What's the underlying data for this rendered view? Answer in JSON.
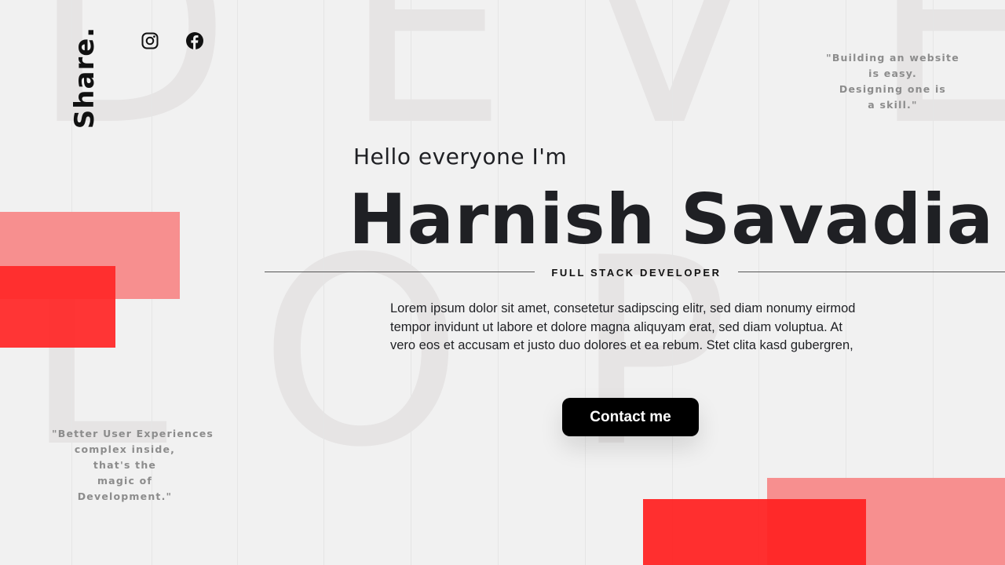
{
  "background_letters": [
    "D",
    "E",
    "V",
    "E",
    "L",
    "O",
    "P"
  ],
  "share": {
    "label": "Share.",
    "social": [
      "instagram-icon",
      "facebook-icon"
    ]
  },
  "quotes": {
    "top_right": [
      "\"Building an website",
      "is easy.",
      "Designing one is",
      "a skill.\""
    ],
    "bottom_left": [
      "\"Better User Experiences",
      "complex inside,",
      "that's the",
      "magic of",
      "Development.\""
    ]
  },
  "hero": {
    "greeting": "Hello everyone I'm",
    "name": "Harnish Savadia",
    "role": "FULL STACK DEVELOPER",
    "description": [
      "Lorem ipsum dolor sit amet, consetetur sadipscing elitr, sed diam nonumy eirmod",
      "tempor invidunt ut labore et dolore magna aliquyam erat, sed diam voluptua. At",
      "vero eos et accusam et justo duo dolores et ea rebum. Stet clita kasd gubergren,"
    ],
    "cta_label": "Contact me"
  },
  "colors": {
    "background": "#f1f1f1",
    "text": "#1f2024",
    "accent_red": "#ff2424",
    "accent_pink": "#f78f8f",
    "button": "#000000"
  }
}
